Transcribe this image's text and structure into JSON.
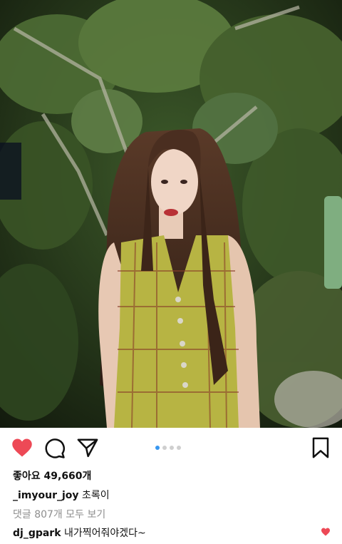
{
  "post": {
    "likes_label": "좋아요 49,660개",
    "caption": {
      "username": "_imyour_joy",
      "text": "초록이"
    },
    "view_comments_label": "댓글 807개 모두 보기",
    "comment": {
      "username": "dj_gpark",
      "text": "내가찍어줘야겠다~"
    }
  },
  "carousel": {
    "total": 4,
    "active_index": 1
  },
  "colors": {
    "like_red": "#ed4956",
    "dot_active": "#3897f0",
    "dot_inactive": "#cfcfcf",
    "muted_text": "#8e8e8e"
  },
  "icons": [
    "heart-icon",
    "comment-icon",
    "send-icon",
    "bookmark-icon",
    "small-heart-icon"
  ]
}
